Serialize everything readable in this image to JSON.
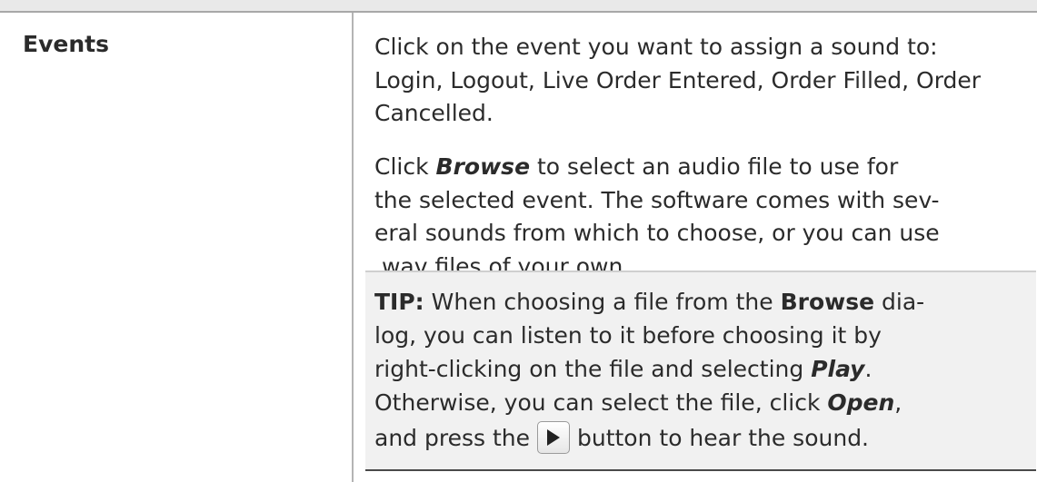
{
  "events_row": {
    "term": "Events",
    "paragraph1": "Click on the event you want to assign a sound to: Login, Logout, Live Order Entered, Order Filled, Order Cancelled.",
    "paragraph2": {
      "lead": "Click ",
      "browse": "Browse",
      "rest_line1": " to select an audio file to use for",
      "rest_line2": "the selected event. The software comes with sev-",
      "rest_line3": "eral sounds from which to choose, or you can use",
      "rest_line4": ".wav files of your own."
    },
    "tip": {
      "label": "TIP:",
      "line1_a": " When choosing a file from the ",
      "browse": "Browse",
      "line1_b": " dia-",
      "line2": "log, you can listen to it before choosing it by",
      "line3_a": "right-clicking on the file and selecting ",
      "play": "Play",
      "line3_b": ".",
      "line4_a": "Otherwise, you can select the file, click ",
      "open": "Open",
      "line4_b": ",",
      "line5_a": "and press the",
      "line5_b": "button to hear the sound.",
      "play_button_icon": "play-triangle-icon"
    }
  }
}
